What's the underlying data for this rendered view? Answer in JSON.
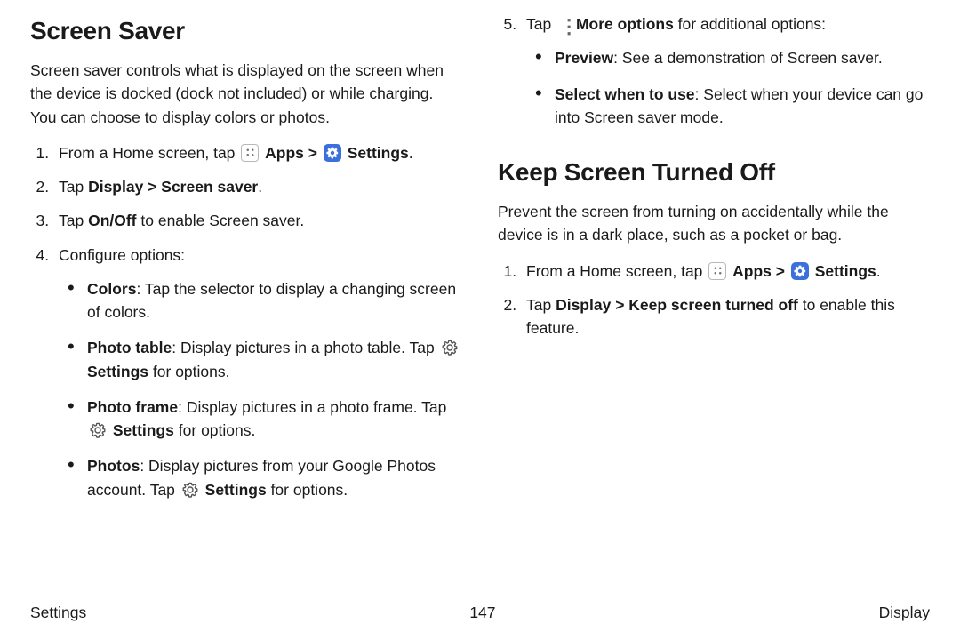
{
  "left": {
    "heading": "Screen Saver",
    "intro": "Screen saver controls what is displayed on the screen when the device is docked (dock not included) or while charging. You can choose to display colors or photos.",
    "steps": {
      "s1_pre": "From a Home screen, tap ",
      "s1_apps": "Apps",
      "s1_chev": " > ",
      "s1_settings": "Settings",
      "s2_pre": "Tap ",
      "s2_bold": "Display > Screen saver",
      "s3_pre": "Tap ",
      "s3_bold": "On/Off",
      "s3_post": " to enable Screen saver.",
      "s4": "Configure options:"
    },
    "opts": {
      "c1_b": "Colors",
      "c1_t": ": Tap the selector to display a changing screen of colors.",
      "c2_b": "Photo table",
      "c2_t1": ": Display pictures in a photo table. Tap ",
      "c2_t2": "Settings",
      "c2_t3": " for options.",
      "c3_b": "Photo frame",
      "c3_t1": ": Display pictures in a photo frame. Tap ",
      "c3_t2": "Settings",
      "c3_t3": " for options.",
      "c4_b": "Photos",
      "c4_t1": ": Display pictures from your Google Photos account. Tap ",
      "c4_t2": "Settings",
      "c4_t3": " for options."
    }
  },
  "right": {
    "step5_pre": "Tap ",
    "step5_bold": "More options",
    "step5_post": " for additional options:",
    "opts": {
      "p1_b": "Preview",
      "p1_t": ": See a demonstration of Screen saver.",
      "p2_b": "Select when to use",
      "p2_t": ": Select when your device can go into Screen saver mode."
    },
    "heading2": "Keep Screen Turned Off",
    "intro2": "Prevent the screen from turning on accidentally while the device is in a dark place, such as a pocket or bag.",
    "steps2": {
      "s1_pre": "From a Home screen, tap ",
      "s1_apps": "Apps",
      "s1_chev": " > ",
      "s1_settings": "Settings",
      "s2_pre": "Tap ",
      "s2_bold": "Display > Keep screen turned off",
      "s2_post": " to enable this feature."
    }
  },
  "footer": {
    "left": "Settings",
    "center": "147",
    "right": "Display"
  }
}
